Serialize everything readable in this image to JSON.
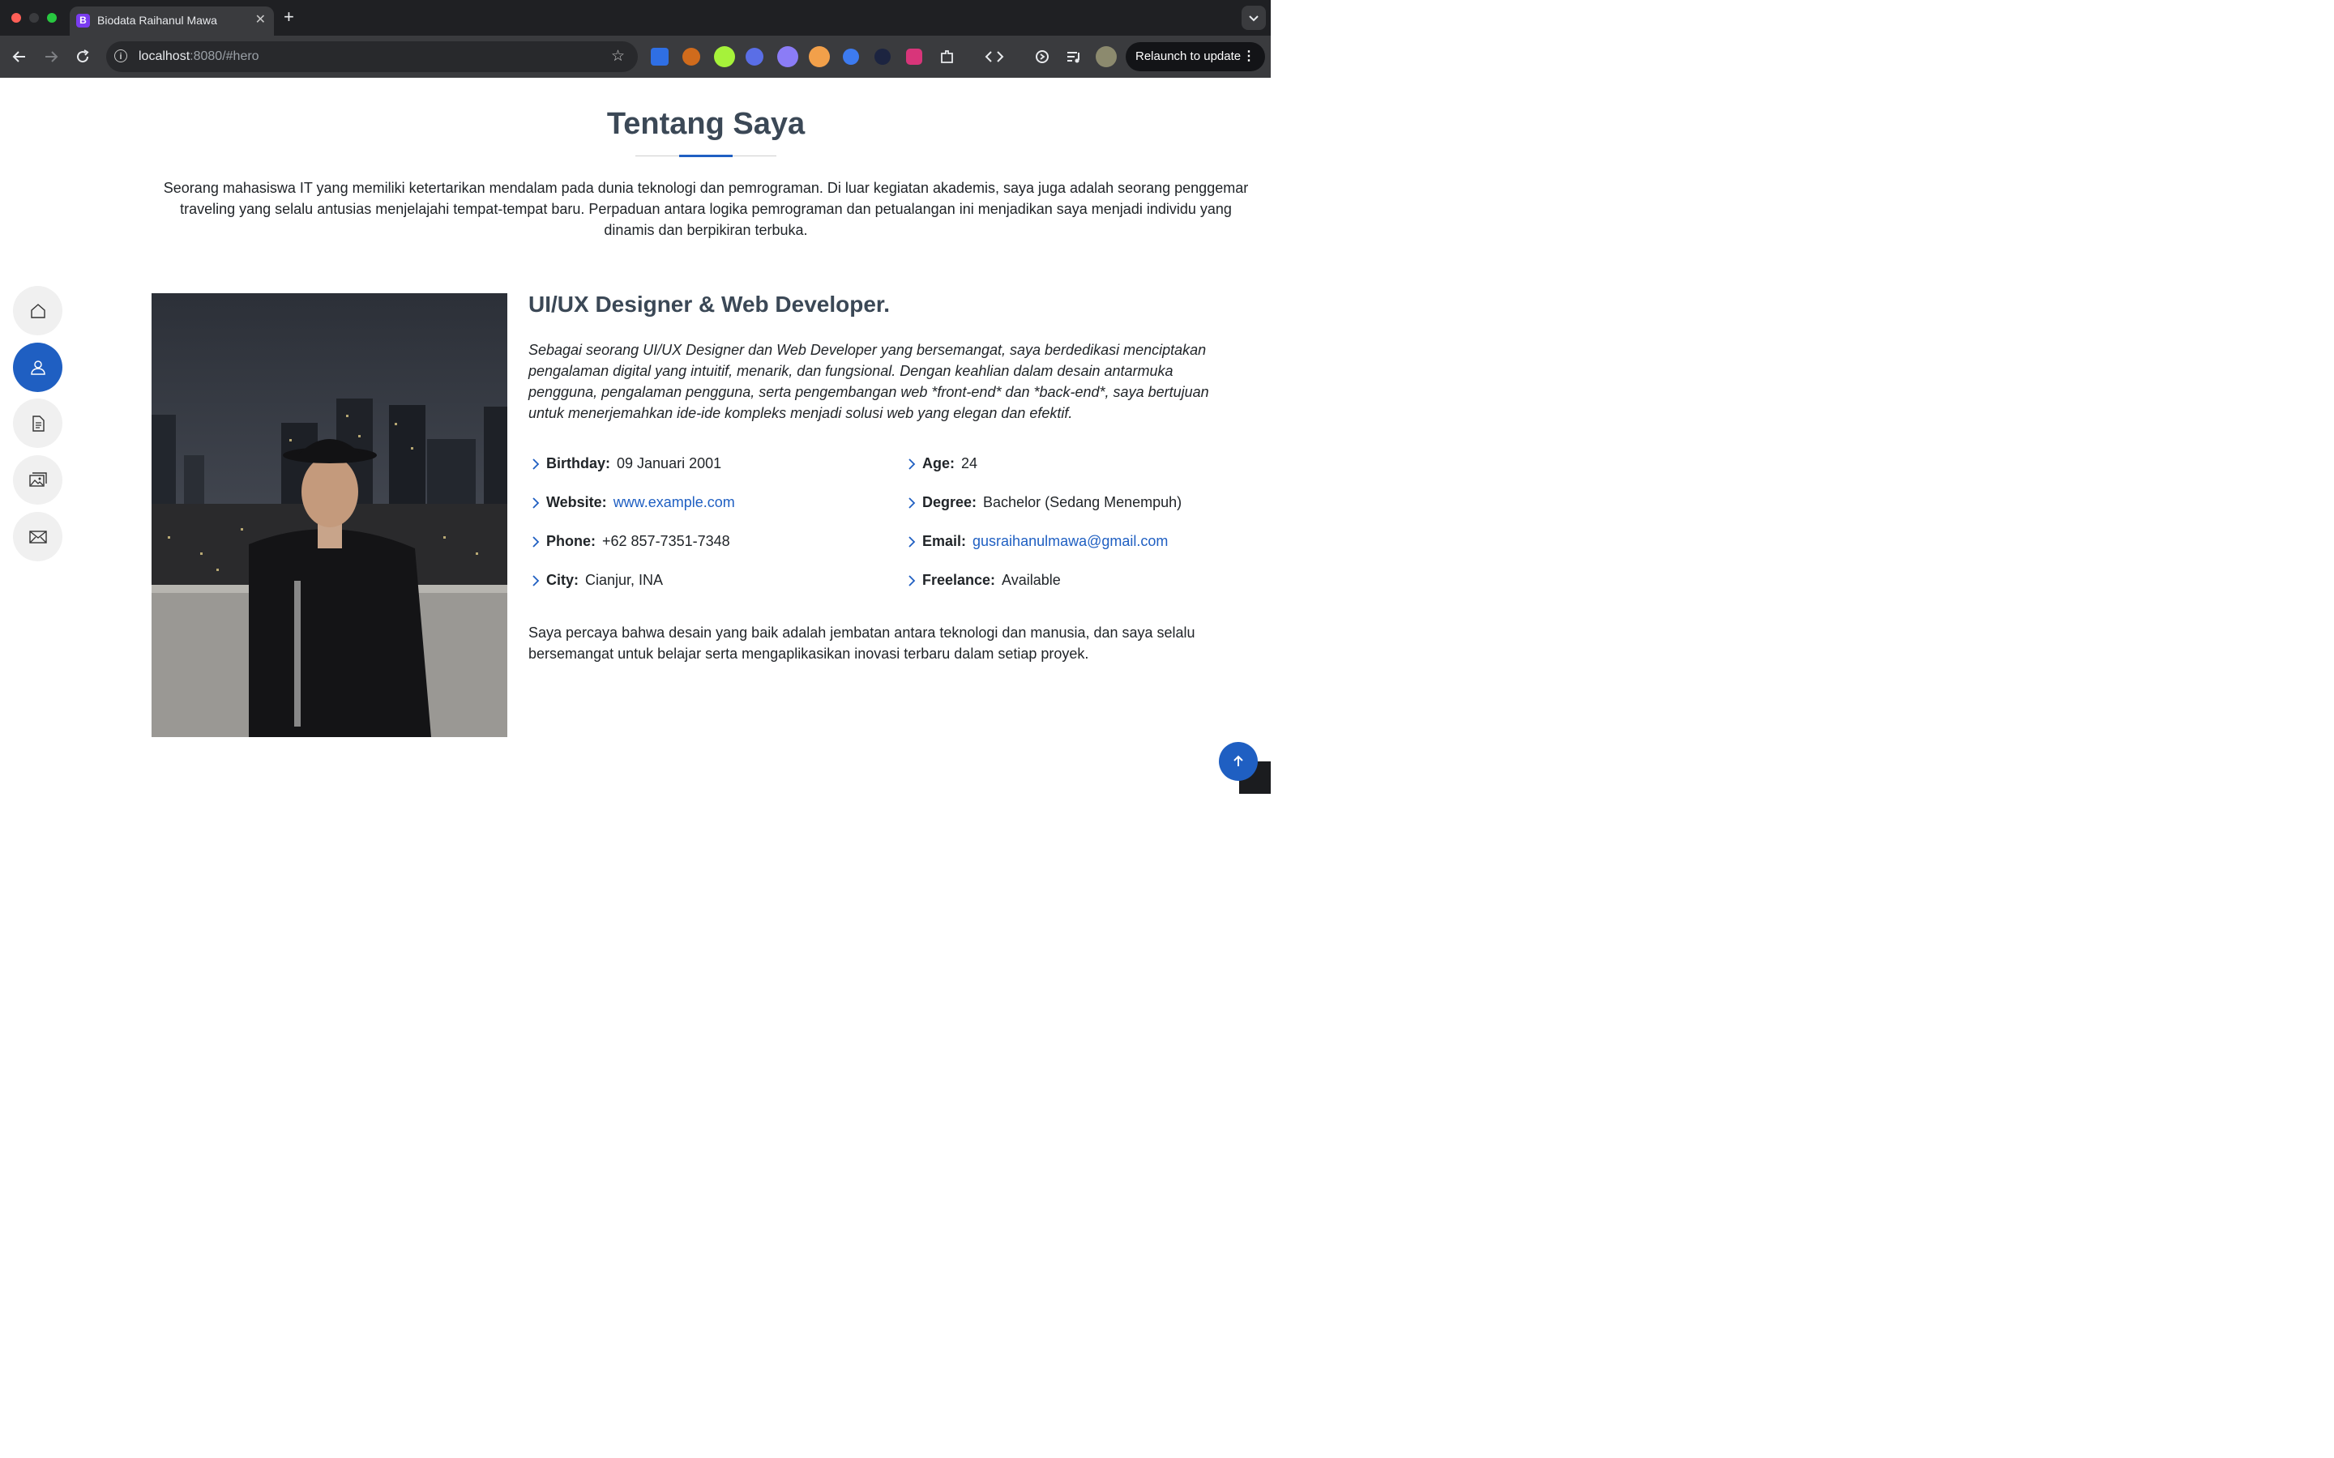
{
  "browser": {
    "tab_title": "Biodata Raihanul Mawa",
    "tab_favicon_letter": "B",
    "url_host": "localhost",
    "url_rest": ":8080/#hero",
    "relaunch_label": "Relaunch to update",
    "extensions": [
      "bolt-extension-icon",
      "metamask-style-icon",
      "green-grid-icon",
      "blue-hand-icon",
      "ghost-icon",
      "fox-wallet-icon",
      "record-icon",
      "dark-circle-icon",
      "shield-u-icon",
      "puzzle-icon",
      "code-icon",
      "refresh-sync-icon",
      "media-icon",
      "profile-avatar-icon"
    ]
  },
  "about": {
    "title": "Tentang Saya",
    "intro": "Seorang mahasiswa IT yang memiliki ketertarikan mendalam pada dunia teknologi dan pemrograman. Di luar kegiatan akademis, saya juga adalah seorang penggemar traveling yang selalu antusias menjelajahi tempat-tempat baru. Perpaduan antara logika pemrograman dan petualangan ini menjadikan saya menjadi individu yang dinamis dan berpikiran terbuka.",
    "role": "UI/UX Designer & Web Developer.",
    "bio": "Sebagai seorang UI/UX Designer dan Web Developer yang bersemangat, saya berdedikasi menciptakan pengalaman digital yang intuitif, menarik, dan fungsional. Dengan keahlian dalam desain antarmuka pengguna, pengalaman pengguna, serta pengembangan web *front-end* dan *back-end*, saya bertujuan untuk menerjemahkan ide-ide kompleks menjadi solusi web yang elegan dan efektif.",
    "closing": "Saya percaya bahwa desain yang baik adalah jembatan antara teknologi dan manusia, dan saya selalu bersemangat untuk belajar serta mengaplikasikan inovasi terbaru dalam setiap proyek.",
    "info_left": [
      {
        "label": "Birthday:",
        "value": "09 Januari 2001"
      },
      {
        "label": "Website:",
        "value": "www.example.com"
      },
      {
        "label": "Phone:",
        "value": "+62 857-7351-7348"
      },
      {
        "label": "City:",
        "value": "Cianjur, INA"
      }
    ],
    "info_right": [
      {
        "label": "Age:",
        "value": "24"
      },
      {
        "label": "Degree:",
        "value": "Bachelor (Sedang Menempuh)"
      },
      {
        "label": "Email:",
        "value": "gusraihanulmawa@gmail.com"
      },
      {
        "label": "Freelance:",
        "value": "Available"
      }
    ]
  },
  "sidenav": {
    "items": [
      "home-icon",
      "person-icon",
      "document-icon",
      "images-icon",
      "envelope-icon"
    ],
    "active": "person-icon"
  },
  "colors": {
    "accent": "#1f5fc2",
    "heading": "#3b4856",
    "text": "#212529"
  }
}
